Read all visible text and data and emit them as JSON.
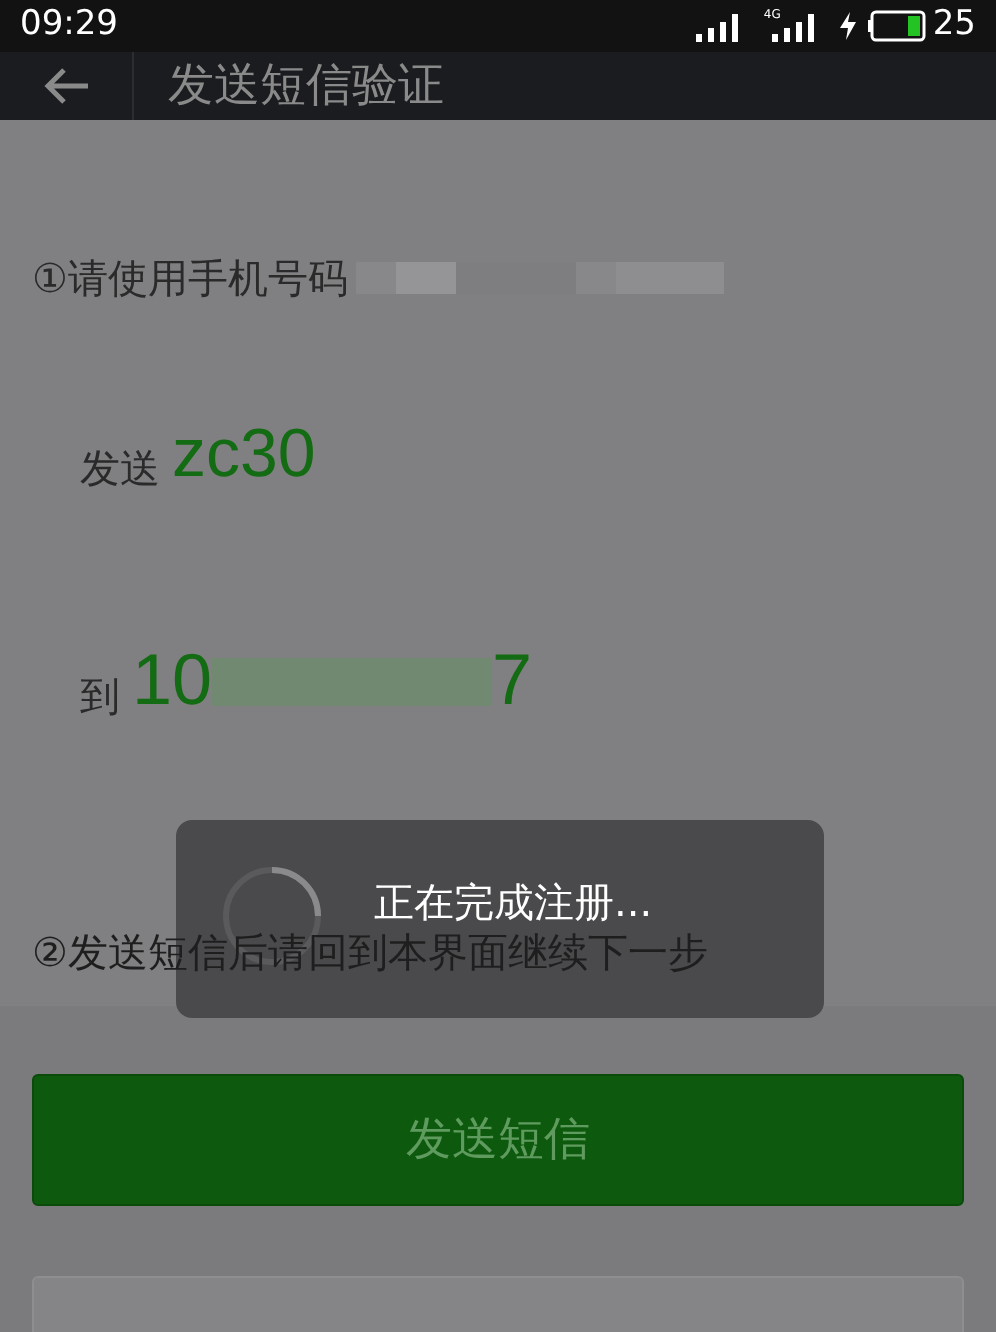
{
  "status_bar": {
    "time": "09:29",
    "network": "4G",
    "battery": "25"
  },
  "header": {
    "title": "发送短信验证"
  },
  "step1": {
    "text": "①请使用手机号码"
  },
  "send_line": {
    "label": "发送",
    "code": "zc30"
  },
  "to_line": {
    "label": "到",
    "number_start": "10",
    "number_end": "7"
  },
  "step2": {
    "text": "②发送短信后请回到本界面继续下一步"
  },
  "toast": {
    "text": "正在完成注册..."
  },
  "send_button": {
    "label": "发送短信"
  }
}
